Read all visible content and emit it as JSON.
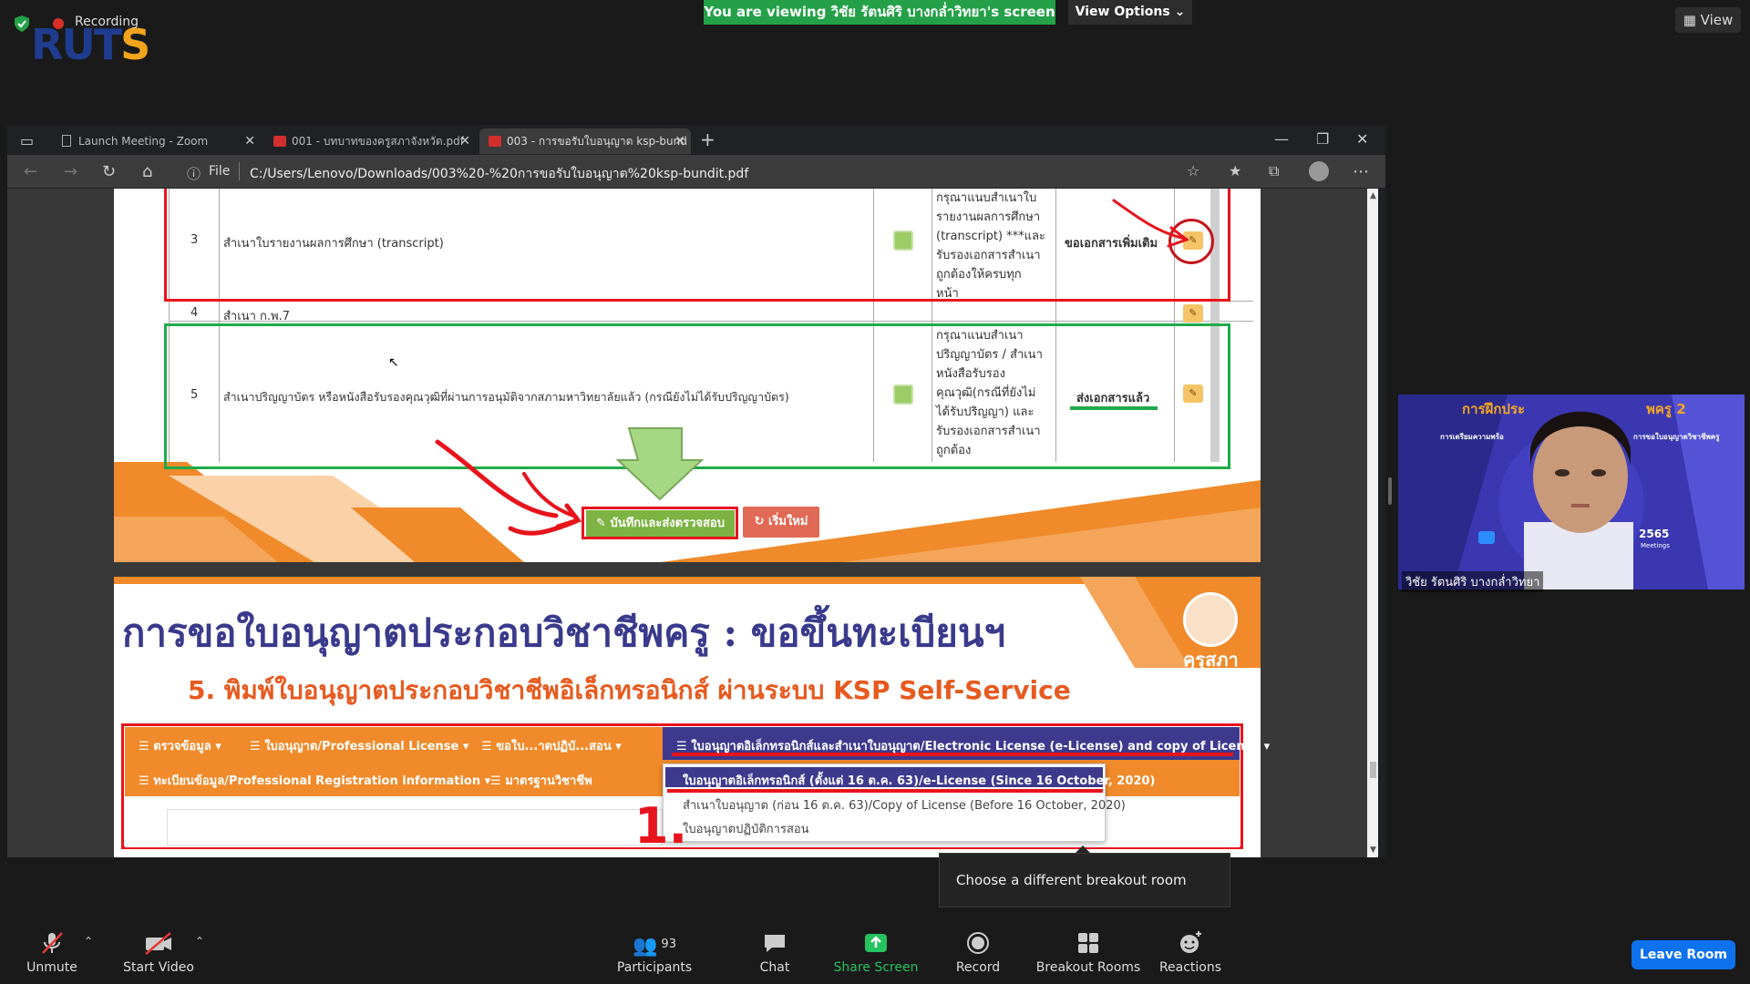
{
  "zoom": {
    "recording_label": "Recording",
    "viewing_banner": "You are viewing วิชัย รัตนศิริ  บางกล่ำวิทยา's screen",
    "view_options": "View Options ⌄",
    "view_button": "View",
    "logo_text": "RUTS",
    "tooltip": "Choose a different breakout room",
    "toolbar": {
      "unmute": "Unmute",
      "start_video": "Start Video",
      "participants": "Participants",
      "participants_count": "93",
      "chat": "Chat",
      "share_screen": "Share Screen",
      "record": "Record",
      "breakout_rooms": "Breakout Rooms",
      "reactions": "Reactions",
      "leave_room": "Leave Room"
    },
    "camera_name": "วิชัย รัตนศิริ  บางกล่ำวิทยา",
    "camera_bg_title": "การฝึกประ",
    "camera_bg_badge": "พครู 2",
    "camera_bg_line1": "การเตรียมความพร้อ",
    "camera_bg_line2": "การขอใบอนุญาตวิชาชีพครู",
    "camera_bg_year": "2565",
    "camera_bg_meetings": "Meetings"
  },
  "browser": {
    "tabs": [
      {
        "label": "Launch Meeting - Zoom",
        "icon": "page-icon"
      },
      {
        "label": "001 - บทบาทของครูสภาจังหวัด.pdf",
        "icon": "pdf-icon"
      },
      {
        "label": "003 - การขอรับใบอนุญาต ksp-bund",
        "icon": "pdf-icon"
      }
    ],
    "url_scheme": "File",
    "url": "C:/Users/Lenovo/Downloads/003%20-%20การขอรับใบอนุญาต%20ksp-bundit.pdf"
  },
  "table": {
    "rows": [
      {
        "num": "3",
        "desc": "สำเนาใบรายงานผลการศึกษา (transcript)",
        "note_lines": [
          "กรุณาแนบสำเนาใบ",
          "รายงานผลการศึกษา",
          "(transcript) ***และ",
          "รับรองเอกสารสำเนา",
          "ถูกต้องให้ครบทุก",
          "หน้า"
        ],
        "status": "ขอเอกสารเพิ่มเติม"
      },
      {
        "num": "4",
        "desc": "สำเนา ก.พ.7",
        "note_lines": [],
        "status": ""
      },
      {
        "num": "5",
        "desc": "สำเนาปริญญาบัตร หรือหนังสือรับรองคุณวุฒิที่ผ่านการอนุมัติจากสภามหาวิทยาลัยแล้ว (กรณียังไม่ได้รับปริญญาบัตร)",
        "note_lines": [
          "กรุณาแนบสำเนา",
          "ปริญญาบัตร / สำเนา",
          "หนังสือรับรอง",
          "คุณวุฒิ(กรณีที่ยังไม่",
          "ได้รับปริญญา) และ",
          "รับรองเอกสารสำเนา",
          "ถูกต้อง"
        ],
        "status": "ส่งเอกสารแล้ว"
      }
    ],
    "save_button": "บันทึกและส่งตรวจสอบ",
    "reset_button": "เริ่มใหม่"
  },
  "slide": {
    "title": "การขอใบอนุญาตประกอบวิชาชีพครู : ขอขึ้นทะเบียนฯ",
    "subtitle": "5. พิมพ์ใบอนุญาตประกอบวิชาชีพอิเล็กทรอนิกส์ ผ่านระบบ KSP Self-Service",
    "org_name": "คุรุสภา",
    "menu": {
      "check": "ตรวจข้อมูล ▾",
      "license": "ใบอนุญาต/Professional License ▾",
      "practice": "ขอใบ...าตปฏิบั...สอน ▾",
      "elicense": "ใบอนุญาตอิเล็กทรอนิกส์และสำเนาใบอนุญาต/Electronic License (e-License) and copy of License ▾",
      "registration": "ทะเบียนข้อมูล/Professional Registration information ▾",
      "standard": "มาตรฐานวิชาชีพ"
    },
    "dropdown": [
      "ใบอนุญาตอิเล็กทรอนิกส์ (ตั้งแต่ 16 ต.ค. 63)/e-License (Since 16 October, 2020)",
      "สำเนาใบอนุญาต (ก่อน 16 ต.ค. 63)/Copy of License (Before 16 October, 2020)",
      "ใบอนุญาตปฏิบัติการสอน"
    ],
    "annotation_number": "1."
  },
  "colors": {
    "zoom_green": "#24a148",
    "annotation_red": "#e8141c",
    "annotation_green": "#1faa4a",
    "orange": "#f08a2a",
    "menu_purple": "#3d3a8e",
    "leave_blue": "#0e72ed"
  }
}
